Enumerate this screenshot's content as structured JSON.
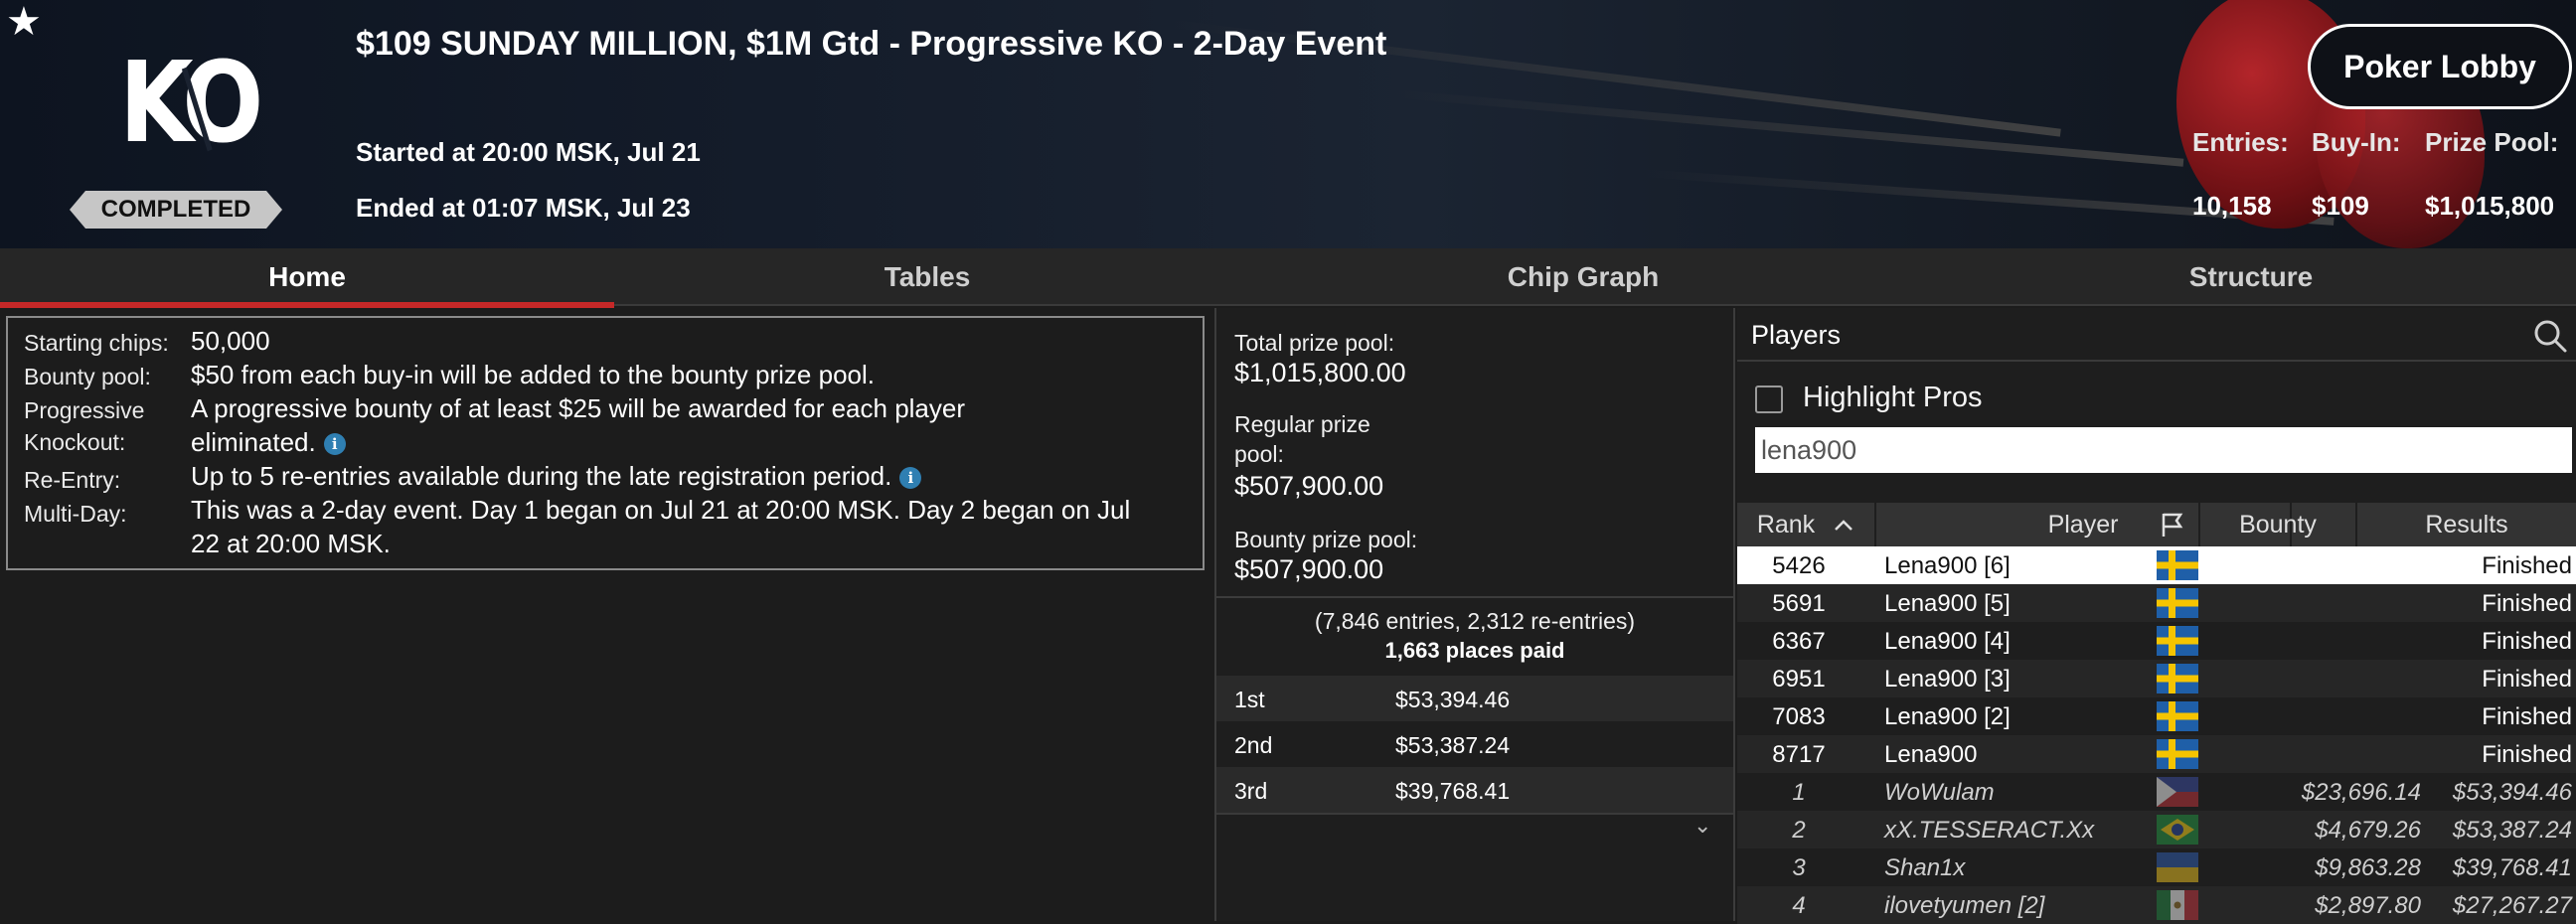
{
  "header": {
    "favorite_icon": "star-icon",
    "logo_text": "KO",
    "status": "COMPLETED",
    "title": "$109 SUNDAY MILLION, $1M Gtd - Progressive KO - 2-Day Event",
    "started": "Started at 20:00 MSK, Jul 21",
    "ended": "Ended at 01:07 MSK, Jul 23",
    "lobby_button": "Poker Lobby",
    "stats": {
      "entries_label": "Entries:",
      "entries_value": "10,158",
      "buyin_label": "Buy-In:",
      "buyin_value": "$109",
      "prizepool_label": "Prize Pool:",
      "prizepool_value": "$1,015,800"
    }
  },
  "tabs": [
    {
      "label": "Home",
      "active": true
    },
    {
      "label": "Tables",
      "active": false
    },
    {
      "label": "Chip Graph",
      "active": false
    },
    {
      "label": "Structure",
      "active": false
    }
  ],
  "info": {
    "starting_chips_label": "Starting chips:",
    "starting_chips_value": "50,000",
    "bounty_pool_label": "Bounty pool:",
    "bounty_pool_value": "$50 from each buy-in will be added to the bounty prize pool.",
    "progressive_label_1": "Progressive",
    "progressive_label_2": "Knockout:",
    "progressive_value_1": "A progressive bounty of at least $25 will be awarded for each player",
    "progressive_value_2": "eliminated.",
    "reentry_label": "Re-Entry:",
    "reentry_value": "Up to 5 re-entries available during the late registration period.",
    "multiday_label": "Multi-Day:",
    "multiday_value_1": "This was a 2-day event. Day 1 began on Jul 21 at 20:00 MSK. Day 2 began on Jul",
    "multiday_value_2": "22 at 20:00 MSK.",
    "info_icon": "i"
  },
  "prize": {
    "total_label": "Total prize pool:",
    "total_value": "$1,015,800.00",
    "regular_label_1": "Regular prize",
    "regular_label_2": "pool:",
    "regular_value": "$507,900.00",
    "bounty_label": "Bounty prize pool:",
    "bounty_value": "$507,900.00",
    "entries_info": "(7,846 entries, 2,312 re-entries)",
    "places_paid": "1,663 places paid",
    "payouts": [
      {
        "place": "1st",
        "amount": "$53,394.46"
      },
      {
        "place": "2nd",
        "amount": "$53,387.24"
      },
      {
        "place": "3rd",
        "amount": "$39,768.41"
      }
    ],
    "chevron_icon": "chevron-down-icon"
  },
  "players": {
    "title": "Players",
    "highlight_label": "Highlight Pros",
    "highlight_checked": false,
    "search_value": "lena900",
    "columns": {
      "rank": "Rank",
      "player": "Player",
      "bounty": "Bounty",
      "results": "Results"
    },
    "rows": [
      {
        "rank": "5426",
        "player": "Lena900 [6]",
        "flag": "SE",
        "bounty": "",
        "result": "Finished",
        "selected": true
      },
      {
        "rank": "5691",
        "player": "Lena900 [5]",
        "flag": "SE",
        "bounty": "",
        "result": "Finished",
        "selected": false
      },
      {
        "rank": "6367",
        "player": "Lena900 [4]",
        "flag": "SE",
        "bounty": "",
        "result": "Finished",
        "selected": false
      },
      {
        "rank": "6951",
        "player": "Lena900 [3]",
        "flag": "SE",
        "bounty": "",
        "result": "Finished",
        "selected": false
      },
      {
        "rank": "7083",
        "player": "Lena900 [2]",
        "flag": "SE",
        "bounty": "",
        "result": "Finished",
        "selected": false
      },
      {
        "rank": "8717",
        "player": "Lena900",
        "flag": "SE",
        "bounty": "",
        "result": "Finished",
        "selected": false
      },
      {
        "rank": "1",
        "player": "WoWulam",
        "flag": "PH",
        "bounty": "$23,696.14",
        "result": "$53,394.46",
        "selected": false
      },
      {
        "rank": "2",
        "player": "xX.TESSERACT.Xx",
        "flag": "BR",
        "bounty": "$4,679.26",
        "result": "$53,387.24",
        "selected": false
      },
      {
        "rank": "3",
        "player": "Shan1x",
        "flag": "UA",
        "bounty": "$9,863.28",
        "result": "$39,768.41",
        "selected": false
      },
      {
        "rank": "4",
        "player": "ilovetyumen [2]",
        "flag": "MX",
        "bounty": "$2,897.80",
        "result": "$27,267.27",
        "selected": false
      }
    ]
  }
}
